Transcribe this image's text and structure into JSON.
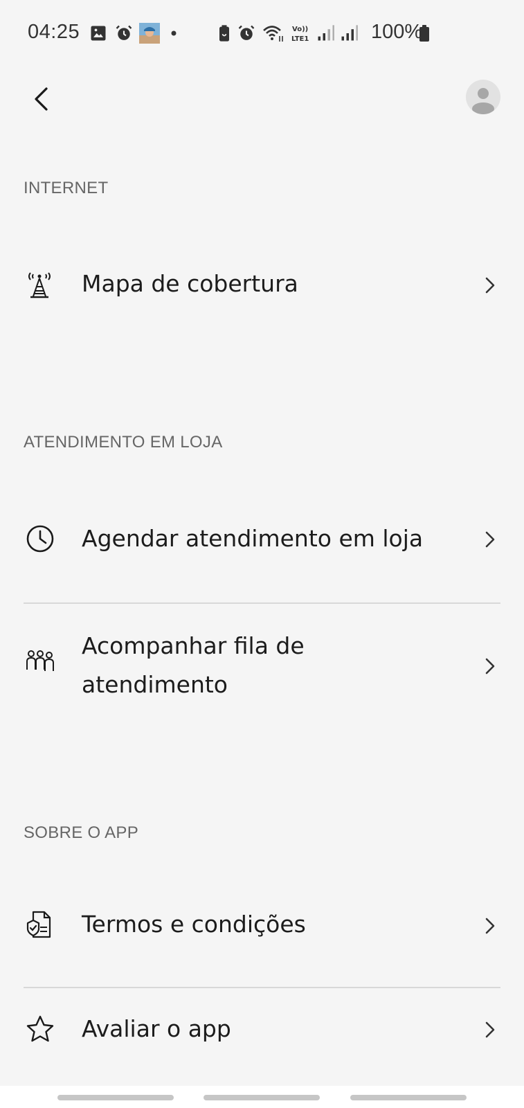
{
  "status_bar": {
    "time": "04:25",
    "battery": "100%",
    "icons": [
      "gallery-icon",
      "alarm-icon",
      "app-avatar-icon",
      "dot-icon",
      "battery-saver-icon",
      "alarm-icon",
      "wifi-icon",
      "volte-lte-icon",
      "signal-icon",
      "signal-icon",
      "battery-icon"
    ]
  },
  "header": {
    "back_icon": "chevron-left-icon",
    "avatar_icon": "user-avatar-icon"
  },
  "sections": [
    {
      "title": "INTERNET",
      "items": [
        {
          "label": "Mapa de cobertura",
          "icon": "antenna-icon"
        }
      ]
    },
    {
      "title": "ATENDIMENTO EM LOJA",
      "items": [
        {
          "label": "Agendar atendimento em loja",
          "icon": "clock-icon"
        },
        {
          "label": "Acompanhar fila de atendimento",
          "icon": "queue-people-icon"
        }
      ]
    },
    {
      "title": "SOBRE O APP",
      "items": [
        {
          "label": "Termos e condições",
          "icon": "document-check-icon"
        },
        {
          "label": "Avaliar o app",
          "icon": "star-icon"
        }
      ]
    }
  ],
  "colors": {
    "background": "#f5f5f5",
    "section_header": "#666666",
    "text": "#1c1c1c",
    "divider": "#d8d8d8"
  }
}
